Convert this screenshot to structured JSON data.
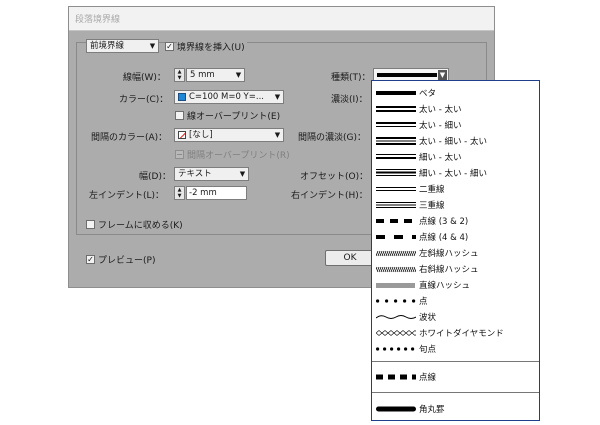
{
  "dialog": {
    "title": "段落境界線",
    "position_select": "前境界線",
    "insert_rule_label": "境界線を挿入(U)",
    "insert_rule_checked": true,
    "weight_label": "線幅(W)：",
    "weight_value": "5 mm",
    "type_label": "種類(T)：",
    "color_label": "カラー(C)：",
    "color_value": "C=100 M=0 Y=...",
    "tint_label": "濃淡(I)：",
    "overprint_label": "線オーバープリント(E)",
    "gap_color_label": "間隔のカラー(A)：",
    "gap_color_value": "[なし]",
    "gap_tint_label": "間隔の濃淡(G)：",
    "gap_overprint_label": "間隔オーバープリント(R)",
    "width_label": "幅(D)：",
    "width_value": "テキスト",
    "offset_label": "オフセット(O)：",
    "left_indent_label": "左インデント(L)：",
    "left_indent_value": "-2 mm",
    "right_indent_label": "右インデント(H)：",
    "keep_in_frame_label": "フレームに収める(K)",
    "preview_label": "プレビュー(P)",
    "preview_checked": true,
    "ok_label": "OK"
  },
  "stroke_types": [
    {
      "label": "ベタ",
      "icon": "solid-line-icon"
    },
    {
      "label": "太い - 太い",
      "icon": "thick-thick-line-icon"
    },
    {
      "label": "太い - 細い",
      "icon": "thick-thin-line-icon"
    },
    {
      "label": "太い - 細い - 太い",
      "icon": "thick-thin-thick-line-icon"
    },
    {
      "label": "細い - 太い",
      "icon": "thin-thick-line-icon"
    },
    {
      "label": "細い - 太い - 細い",
      "icon": "thin-thick-thin-line-icon"
    },
    {
      "label": "二重線",
      "icon": "double-line-icon"
    },
    {
      "label": "三重線",
      "icon": "triple-line-icon"
    },
    {
      "label": "点線 (3 & 2)",
      "icon": "dashed-3-2-icon"
    },
    {
      "label": "点線 (4 & 4)",
      "icon": "dashed-4-4-icon"
    },
    {
      "label": "左斜線ハッシュ",
      "icon": "left-slant-hash-icon"
    },
    {
      "label": "右斜線ハッシュ",
      "icon": "right-slant-hash-icon"
    },
    {
      "label": "直線ハッシュ",
      "icon": "straight-hash-icon"
    },
    {
      "label": "点",
      "icon": "dotted-icon"
    },
    {
      "label": "波状",
      "icon": "wavy-line-icon"
    },
    {
      "label": "ホワイトダイヤモンド",
      "icon": "white-diamond-icon"
    },
    {
      "label": "句点",
      "icon": "japanese-dots-icon"
    }
  ],
  "custom_types": [
    {
      "label": "点線",
      "icon": "dashed-custom-icon"
    }
  ],
  "style_types": [
    {
      "label": "角丸罫",
      "icon": "rounded-rule-icon"
    }
  ],
  "colors": {
    "dialog_bg": "#acacac",
    "popup_border": "#1f3f8c",
    "swatch": "#1f87d6"
  }
}
